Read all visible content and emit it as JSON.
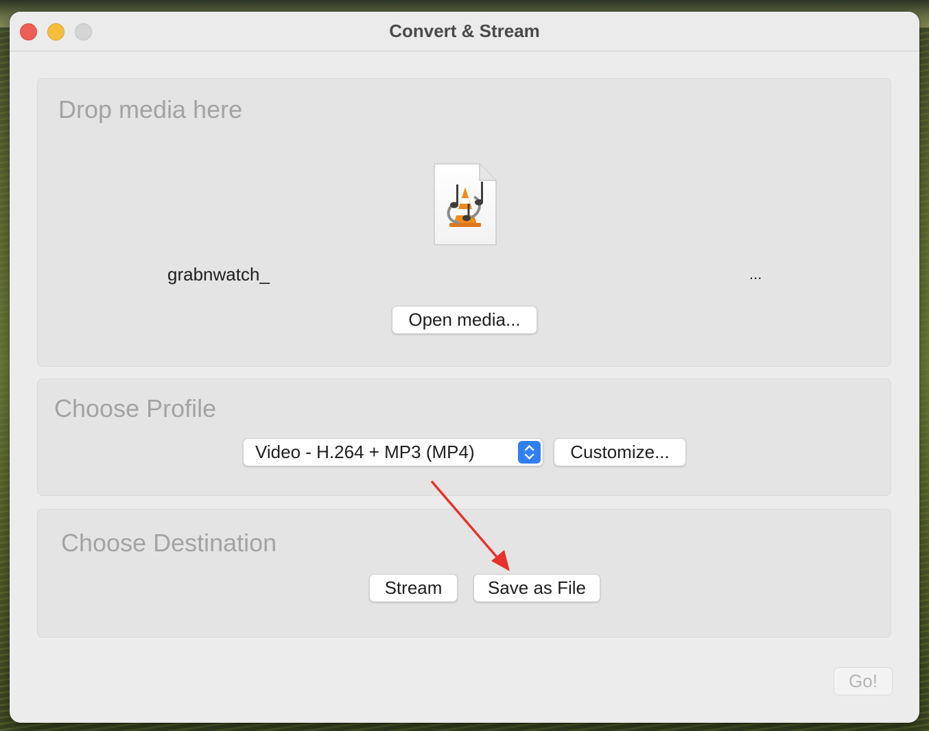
{
  "window": {
    "title": "Convert & Stream"
  },
  "drop_panel": {
    "label": "Drop media here",
    "file_icon": "vlc-media-file-icon",
    "filename": "grabnwatch_",
    "filename_ellipsis": "...",
    "open_button": "Open media..."
  },
  "profile_panel": {
    "label": "Choose Profile",
    "selected_profile": "Video - H.264 + MP3 (MP4)",
    "customize_button": "Customize..."
  },
  "destination_panel": {
    "label": "Choose Destination",
    "stream_button": "Stream",
    "save_button": "Save as File"
  },
  "go_button": "Go!",
  "annotation": {
    "type": "arrow",
    "color": "#e8312b",
    "points_to": "save-as-file-button"
  },
  "colors": {
    "close": "#ee5e56",
    "minimize": "#f6bd3b",
    "zoom_disabled": "#d5d5d5",
    "accent": "#2f7ff6"
  }
}
